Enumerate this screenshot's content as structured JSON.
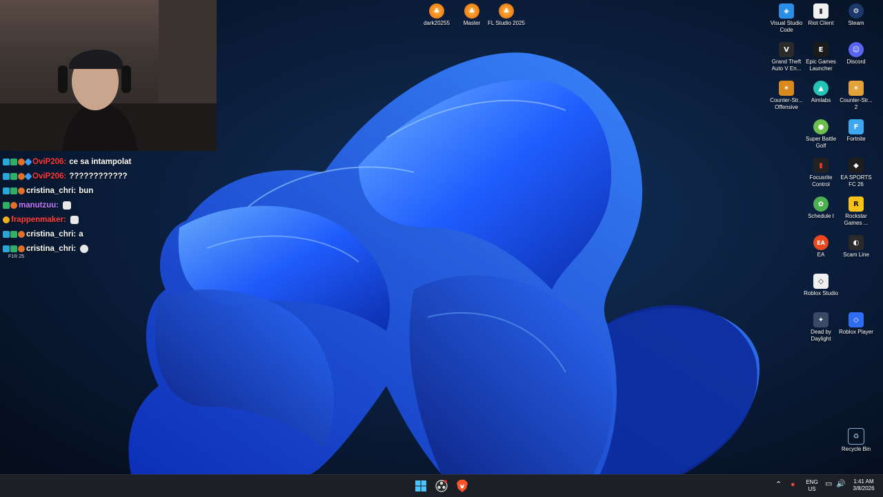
{
  "desktop": {
    "top_icons": [
      {
        "label": "dark20255",
        "icon": "fl-studio-icon"
      },
      {
        "label": "Master",
        "icon": "fl-studio-icon"
      },
      {
        "label": "FL Studio 2025",
        "icon": "fl-studio-icon"
      }
    ],
    "right_icons": [
      {
        "label": "Visual Studio Code",
        "icon": "vscode-icon",
        "color": "#2a8ee6",
        "glyph": "◈"
      },
      {
        "label": "Riot Client",
        "icon": "riot-client-icon",
        "color": "#f0f0f0",
        "glyph": "▮"
      },
      {
        "label": "Steam",
        "icon": "steam-icon",
        "color": "#1b3a6b",
        "glyph": "⚙"
      },
      {
        "label": "Grand Theft Auto V En...",
        "icon": "gta-icon",
        "color": "#2b2b2b",
        "glyph": "V"
      },
      {
        "label": "Epic Games Launcher",
        "icon": "epic-games-icon",
        "color": "#1a1a1a",
        "glyph": "E"
      },
      {
        "label": "Discord",
        "icon": "discord-icon",
        "color": "#5865f2",
        "glyph": "☺"
      },
      {
        "label": "Counter-Str... Offensive",
        "icon": "csgo-icon",
        "color": "#d88a1e",
        "glyph": "✶"
      },
      {
        "label": "Aimlabs",
        "icon": "aimlabs-icon",
        "color": "#23c4b5",
        "glyph": "▲"
      },
      {
        "label": "Counter-Str... 2",
        "icon": "cs2-icon",
        "color": "#e3a33a",
        "glyph": "✶"
      },
      {
        "label": "Super Battle Golf",
        "icon": "golf-icon",
        "color": "#6cbf4a",
        "glyph": "●"
      },
      {
        "label": "Fortnite",
        "icon": "fortnite-icon",
        "color": "#3da8f0",
        "glyph": "F"
      },
      {
        "label": "Focusrite Control",
        "icon": "focusrite-icon",
        "color": "#222222",
        "glyph": "▮"
      },
      {
        "label": "EA SPORTS FC 26",
        "icon": "ea-fc-icon",
        "color": "#1e1e1e",
        "glyph": "◆"
      },
      {
        "label": "Schedule I",
        "icon": "schedule-icon",
        "color": "#4caf50",
        "glyph": "✿"
      },
      {
        "label": "Rockstar Games ...",
        "icon": "rockstar-icon",
        "color": "#f6c21a",
        "glyph": "R"
      },
      {
        "label": "EA",
        "icon": "ea-icon",
        "color": "#e8491d",
        "glyph": "EA"
      },
      {
        "label": "Scam Line",
        "icon": "scam-line-icon",
        "color": "#2a2a2a",
        "glyph": "◐"
      },
      {
        "label": "Roblox Studio",
        "icon": "roblox-studio-icon",
        "color": "#f0f0f0",
        "glyph": "◇"
      },
      {
        "label": "Dead by Daylight",
        "icon": "dbd-icon",
        "color": "#3a4a66",
        "glyph": "✦"
      },
      {
        "label": "Roblox Player",
        "icon": "roblox-player-icon",
        "color": "#2f6df0",
        "glyph": "◇"
      },
      {
        "label": "Recycle Bin",
        "icon": "recycle-bin-icon",
        "color": "#8fb3d1",
        "glyph": "♻"
      }
    ]
  },
  "chat": {
    "messages": [
      {
        "user": "OviP206:",
        "user_color": "#ff3b3b",
        "text": "ce sa intampolat"
      },
      {
        "user": "OviP206:",
        "user_color": "#ff3b3b",
        "text": "????????????"
      },
      {
        "user": "cristina_chri:",
        "user_color": "#ffffff",
        "text": "bun"
      },
      {
        "user": "manutzuu:",
        "user_color": "#c47cff",
        "text": ""
      },
      {
        "user": "frappenmaker:",
        "user_color": "#ff4040",
        "text": ""
      },
      {
        "user": "cristina_chri:",
        "user_color": "#ffffff",
        "text": "a"
      },
      {
        "user": "cristina_chri:",
        "user_color": "#ffffff",
        "text": ""
      }
    ],
    "footer": "F1® 25"
  },
  "taskbar": {
    "lang_line1": "ENG",
    "lang_line2": "US",
    "time": "1:41 AM",
    "date": "3/8/2026"
  },
  "colors": {
    "accent": "#2f6df0",
    "taskbar_bg": "#1c1f26"
  }
}
